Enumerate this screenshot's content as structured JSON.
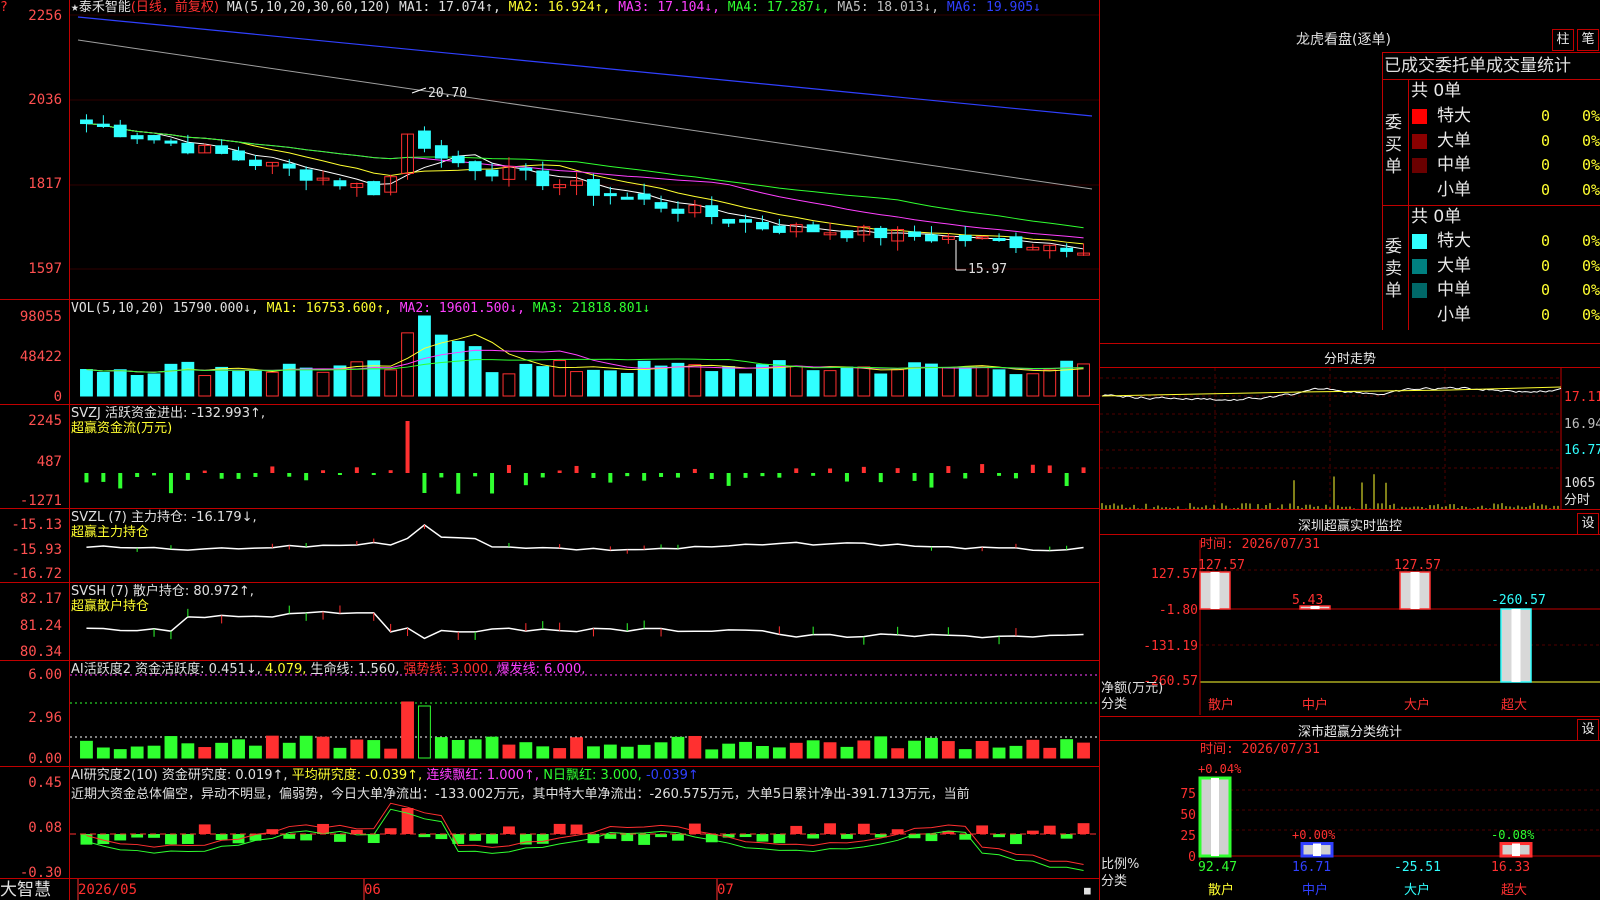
{
  "header": {
    "star": "★",
    "stock_name": "泰禾智能",
    "period": "(日线，前复权)",
    "ma_label": "MA(5,10,20,30,60,120)",
    "ma1": "MA1: 17.074↑,",
    "ma2": "MA2: 16.924↑,",
    "ma3": "MA3: 17.104↓,",
    "ma4": "MA4: 17.287↓,",
    "ma5": "MA5: 18.013↓,",
    "ma6": "MA6: 19.905↓"
  },
  "price_axis": {
    "labels": [
      "2256",
      "2036",
      "1817",
      "1597"
    ]
  },
  "price_annotations": {
    "high": "20.70",
    "low": "15.97"
  },
  "vol_panel": {
    "title": "VOL(5,10,20)",
    "value": "15790.000↓,",
    "ma1": "MA1: 16753.600↑,",
    "ma2": "MA2: 19601.500↓,",
    "ma3": "MA3: 21818.801↓",
    "axis": [
      "98055",
      "48422",
      "0"
    ]
  },
  "svzj_panel": {
    "title": "SVZJ  活跃资金进出: -132.993↑,",
    "subtitle": "超赢资金流(万元)",
    "axis": [
      "2245",
      "487",
      "-1271"
    ]
  },
  "svzl_panel": {
    "title": "SVZL (7) 主力持仓: -16.179↓,",
    "subtitle": "超赢主力持仓",
    "axis": [
      "-15.13",
      "-15.93",
      "-16.72"
    ]
  },
  "svsh_panel": {
    "title": "SVSH (7) 散户持仓: 80.972↑,",
    "subtitle": "超赢散户持仓",
    "axis": [
      "82.17",
      "81.24",
      "80.34"
    ]
  },
  "ai_active_panel": {
    "title": "AI活跃度2 资金活跃度: 0.451↓,",
    "v2": "4.079,",
    "life": "生命线: 1.560,",
    "strong": "强势线: 3.000,",
    "burst": "爆发线: 6.000,",
    "axis": [
      "6.00",
      "2.96",
      "0.00"
    ]
  },
  "ai_research_panel": {
    "title": "AI研究度2(10) 资金研究度: 0.019↑,",
    "avg": "平均研究度: -0.039↑,",
    "red": "连续飘红: 1.000↑,",
    "nday": "N日飘红: 3.000,",
    "last": "-0.039↑",
    "comment": "近期大资金总体偏空，异动不明显，偏弱势，今日大单净流出：-133.002万元，其中特大单净流出：-260.575万元，大单5日累计净出-391.713万元，当前",
    "axis": [
      "0.45",
      "0.08",
      "-0.30"
    ]
  },
  "date_axis": {
    "brand": "大智慧",
    "labels": [
      "2026/05",
      "06",
      "07"
    ]
  },
  "dragon_tiger": {
    "title": "龙虎看盘(逐单)",
    "btn_column": "柱",
    "btn_pen": "笔",
    "tabs": "已成交委托单成交量统计",
    "buy_label": "委买单",
    "sell_label": "委卖单",
    "buy_total": "共 0单",
    "sell_total": "共 0单",
    "buy_rows": [
      {
        "name": "特大",
        "count": "0",
        "pct": "0%",
        "color": "#ff0000"
      },
      {
        "name": "大单",
        "count": "0",
        "pct": "0%",
        "color": "#8b0000"
      },
      {
        "name": "中单",
        "count": "0",
        "pct": "0%",
        "color": "#6a0000"
      },
      {
        "name": "小单",
        "count": "0",
        "pct": "0%",
        "color": ""
      }
    ],
    "sell_rows": [
      {
        "name": "特大",
        "count": "0",
        "pct": "0%",
        "color": "#30ffff"
      },
      {
        "name": "大单",
        "count": "0",
        "pct": "0%",
        "color": "#008080"
      },
      {
        "name": "中单",
        "count": "0",
        "pct": "0%",
        "color": "#006868"
      },
      {
        "name": "小单",
        "count": "0",
        "pct": "0%",
        "color": ""
      }
    ]
  },
  "intraday": {
    "title": "分时走势",
    "axis": [
      "17.11",
      "16.94",
      "16.77"
    ],
    "vol_label": "1065",
    "vol_unit": "分时"
  },
  "monitor": {
    "title": "深圳超赢实时监控",
    "settings": "设",
    "time": "时间: 2026/07/31",
    "axis": [
      "127.57",
      "-1.80",
      "-131.19",
      "-260.57"
    ],
    "unit": "净额(万元)",
    "cat_label": "分类",
    "categories": [
      "散户",
      "中户",
      "大户",
      "超大"
    ],
    "values": [
      "127.57",
      "5.43",
      "127.57",
      "-260.57"
    ]
  },
  "classify": {
    "title": "深市超赢分类统计",
    "settings": "设",
    "time": "时间: 2026/07/31",
    "axis": [
      "75",
      "50",
      "25",
      "0"
    ],
    "ratio_label": "比例%",
    "cat_label": "分类",
    "categories": [
      "散户",
      "中户",
      "大户",
      "超大"
    ],
    "top_labels": [
      "+0.04%",
      "+0.00%",
      "",
      "-0.08%"
    ],
    "bottom_values": [
      "92.47",
      "16.71",
      "-25.51",
      "16.33"
    ],
    "bar_fraction": [
      1.0,
      0.16,
      0.0,
      0.16
    ]
  },
  "colors": {
    "up": "#ff3030",
    "down": "#30ffff",
    "grid": "#c00000"
  }
}
